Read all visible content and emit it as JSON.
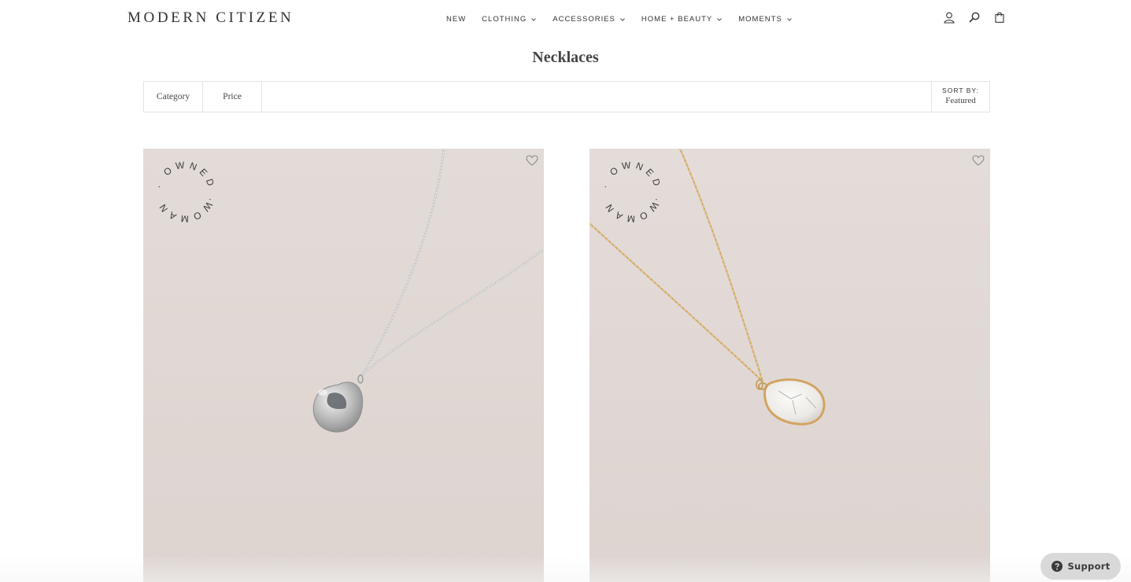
{
  "header": {
    "logo": "MODERN CITIZEN",
    "nav": [
      {
        "label": "NEW",
        "has_dropdown": false
      },
      {
        "label": "CLOTHING",
        "has_dropdown": true
      },
      {
        "label": "ACCESSORIES",
        "has_dropdown": true
      },
      {
        "label": "HOME + BEAUTY",
        "has_dropdown": true
      },
      {
        "label": "MOMENTS",
        "has_dropdown": true
      }
    ],
    "icons": [
      "account-icon",
      "search-icon",
      "bag-icon"
    ]
  },
  "page": {
    "title": "Necklaces"
  },
  "filters": {
    "category_label": "Category",
    "price_label": "Price",
    "sort_label": "SORT BY:",
    "sort_value": "Featured"
  },
  "products": [
    {
      "badge_text": "WOMAN OWNED.",
      "metal": "silver",
      "pendant": "silver disc",
      "wishlist_icon": "heart-icon"
    },
    {
      "badge_text": "WOMAN OWNED.",
      "metal": "gold",
      "pendant": "white howlite teardrop",
      "wishlist_icon": "heart-icon"
    }
  ],
  "support": {
    "label": "Support",
    "icon": "question-icon"
  },
  "colors": {
    "product_bg": "#e4dbd8",
    "text": "#333333",
    "border": "#e4e4e4",
    "support_bg": "#d9d9d9"
  }
}
